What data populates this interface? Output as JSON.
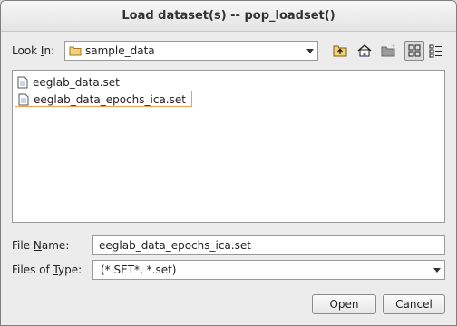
{
  "window": {
    "title": "Load dataset(s) -- pop_loadset()"
  },
  "lookin": {
    "label_pre": "Look ",
    "label_mnemonic": "I",
    "label_post": "n:",
    "value": "sample_data"
  },
  "toolbar": {
    "buttons": [
      {
        "name": "up-folder-icon"
      },
      {
        "name": "home-icon"
      },
      {
        "name": "new-folder-icon"
      },
      {
        "name": "list-view-icon",
        "active": true
      },
      {
        "name": "details-view-icon"
      }
    ]
  },
  "files": [
    {
      "name": "eeglab_data.set",
      "selected": false
    },
    {
      "name": "eeglab_data_epochs_ica.set",
      "selected": true
    }
  ],
  "filename": {
    "label_pre": "File ",
    "label_mnemonic": "N",
    "label_post": "ame:",
    "value": "eeglab_data_epochs_ica.set"
  },
  "filetype": {
    "label_pre": "Files of ",
    "label_mnemonic": "T",
    "label_post": "ype:",
    "value": "(*.SET*, *.set)"
  },
  "buttons": {
    "open": "Open",
    "cancel": "Cancel"
  }
}
